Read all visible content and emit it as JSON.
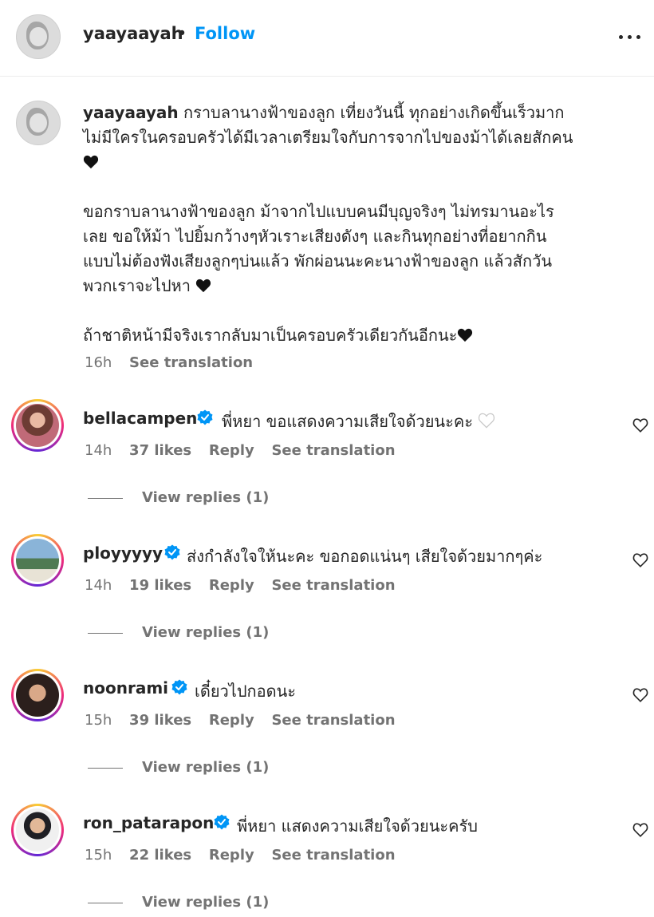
{
  "post": {
    "author": "yaayaayah",
    "separator": "•",
    "follow_label": "Follow",
    "more_icon": "more-horizontal-icon"
  },
  "caption": {
    "author": "yaayaayah",
    "paragraph1": " กราบลานางฟ้าของลูก เที่ยงวันนี้ ทุกอย่างเกิดขึ้นเร็วมาก\nไม่มีใครในครอบครัวได้มีเวลาเตรียมใจกับการจากไปของม้าได้เลยสักคน",
    "paragraph2": "ขอกราบลานางฟ้าของลูก ม้าจากไปแบบคนมีบุญจริงๆ ไม่ทรมานอะไร\nเลย ขอให้ม้า ไปยิ้มกว้างๆหัวเราะเสียงดังๆ และกินทุกอย่างที่อยากกิน\nแบบไม่ต้องฟังเสียงลูกๆบ่นแล้ว พักผ่อนนะคะนางฟ้าของลูก แล้วสักวัน\nพวกเราจะไปหา",
    "paragraph3": "ถ้าชาติหน้ามีจริงเรากลับมาเป็นครอบครัวเดียวกันอีกนะ",
    "emoji": "black-heart-icon",
    "time": "16h",
    "see_translation": "See translation"
  },
  "comments": [
    {
      "username": "bellacampen",
      "text": "พี่หยา ขอแสดงความเสียใจด้วยนะคะ",
      "time": "14h",
      "likes": "37 likes",
      "reply": "Reply",
      "see_translation": "See translation",
      "view_replies": "View replies (1)"
    },
    {
      "username": "ployyyyy",
      "text": "ส่งกำลังใจให้นะคะ ขอกอดแน่นๆ เสียใจด้วยมากๆค่ะ",
      "time": "14h",
      "likes": "19 likes",
      "reply": "Reply",
      "see_translation": "See translation",
      "view_replies": "View replies (1)"
    },
    {
      "username": "noonrami",
      "text": "เดี๋ยวไปกอดนะ",
      "time": "15h",
      "likes": "39 likes",
      "reply": "Reply",
      "see_translation": "See translation",
      "view_replies": "View replies (1)"
    },
    {
      "username": "ron_patarapon",
      "text": "พี่หยา แสดงความเสียใจด้วยนะครับ",
      "time": "15h",
      "likes": "22 likes",
      "reply": "Reply",
      "see_translation": "See translation",
      "view_replies": "View replies (1)"
    }
  ],
  "colors": {
    "link_blue": "#0095f6",
    "verified_blue": "#0095f6",
    "meta_gray": "#737373"
  }
}
